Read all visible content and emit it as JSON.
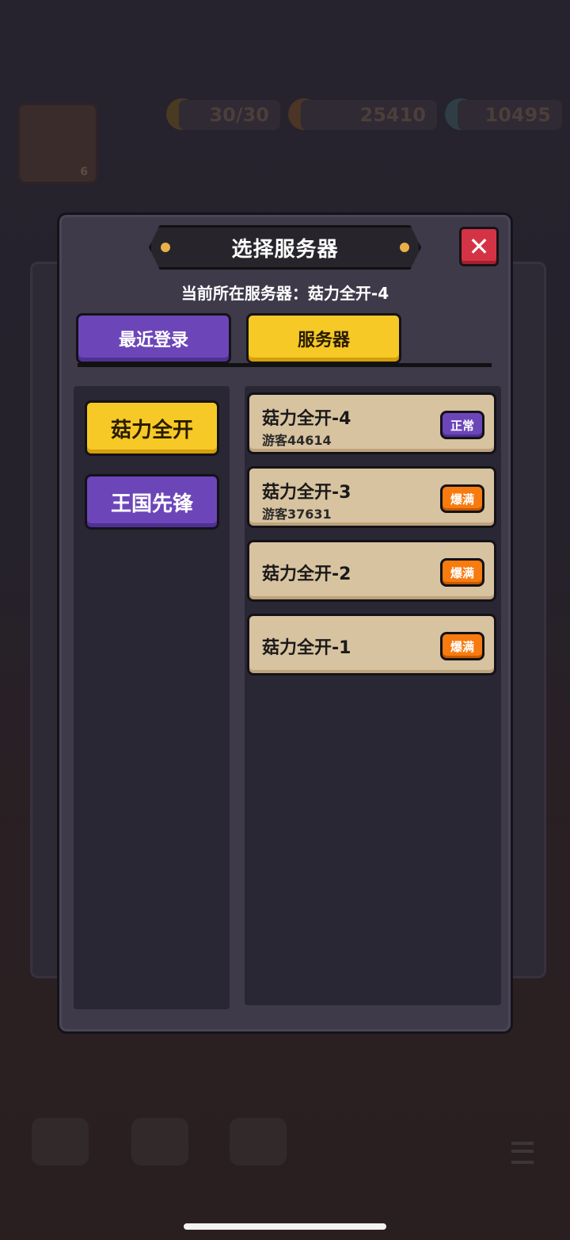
{
  "background": {
    "energy": "30/30",
    "coins": "25410",
    "gems": "10495",
    "avatar_level": "6"
  },
  "dialog": {
    "title": "选择服务器",
    "current_server_label": "当前所在服务器：菇力全开-4",
    "tabs": [
      {
        "label": "最近登录"
      },
      {
        "label": "服务器"
      }
    ],
    "categories": [
      {
        "label": "菇力全开"
      },
      {
        "label": "王国先锋"
      }
    ],
    "servers": [
      {
        "name": "菇力全开-4",
        "user": "游客44614",
        "status": "正常"
      },
      {
        "name": "菇力全开-3",
        "user": "游客37631",
        "status": "爆满"
      },
      {
        "name": "菇力全开-2",
        "user": "",
        "status": "爆满"
      },
      {
        "name": "菇力全开-1",
        "user": "",
        "status": "爆满"
      }
    ],
    "close_icon": "close-icon"
  },
  "colors": {
    "accent_yellow": "#f6c926",
    "accent_purple": "#6c46b9",
    "status_full": "#f77b0f",
    "close_red": "#d43346",
    "card_tan": "#d8c3a0"
  }
}
